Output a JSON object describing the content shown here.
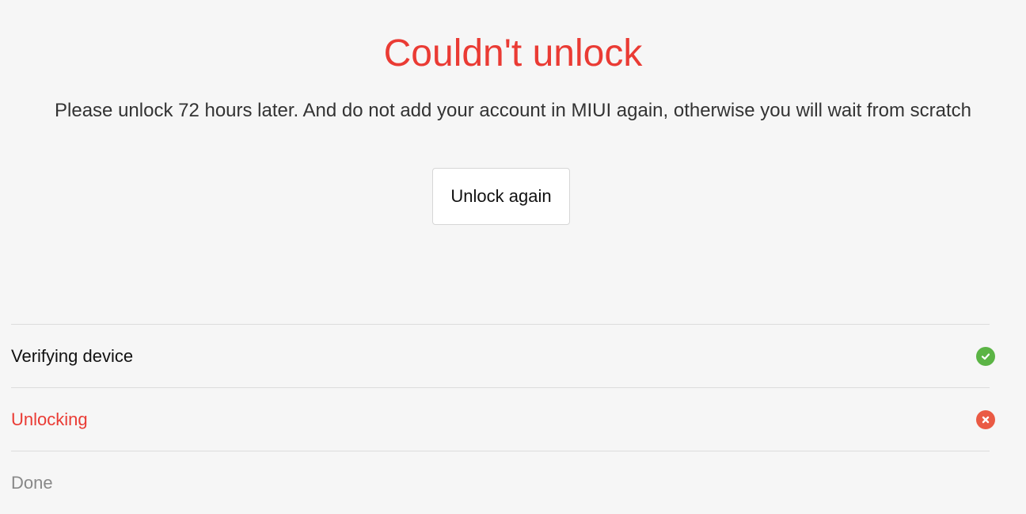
{
  "title": "Couldn't unlock",
  "message": "Please unlock 72 hours later. And do not add your account in MIUI again, otherwise you will wait from scratch",
  "button_label": "Unlock again",
  "colors": {
    "error": "#ea3b34",
    "success": "#5bb445",
    "fail_icon": "#ea5a44"
  },
  "steps": [
    {
      "label": "Verifying device",
      "status": "done",
      "icon": "check-circle-icon"
    },
    {
      "label": "Unlocking",
      "status": "failed",
      "icon": "x-circle-icon"
    },
    {
      "label": "Done",
      "status": "pending",
      "icon": ""
    }
  ]
}
